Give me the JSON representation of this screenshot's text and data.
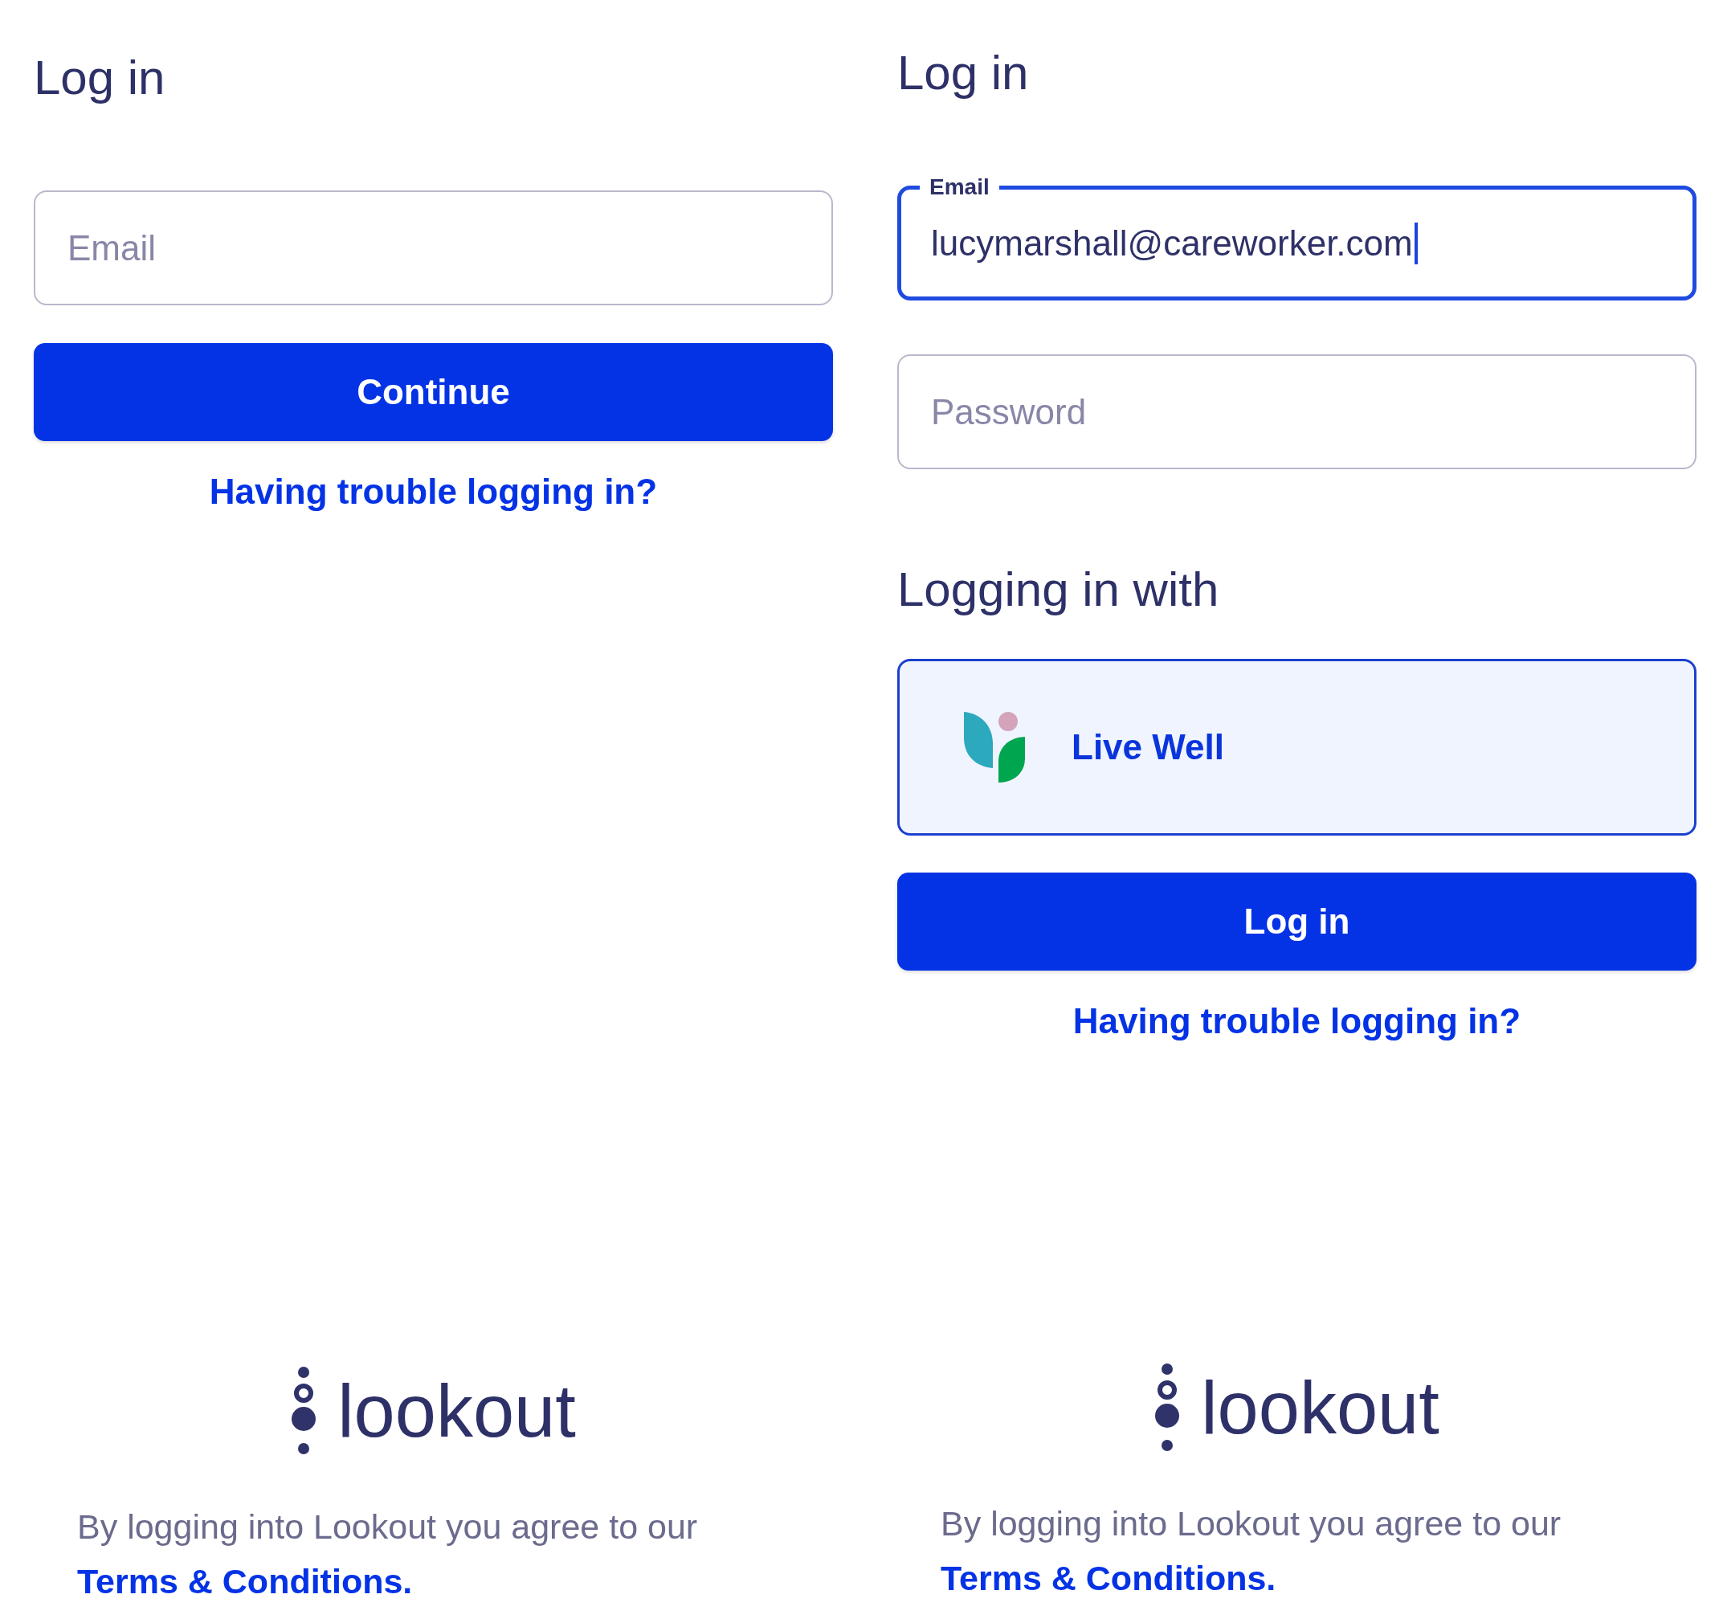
{
  "screens": [
    {
      "title": "Log in",
      "fields": [
        {
          "placeholder": "Email",
          "focused": false
        }
      ],
      "button": "Continue",
      "help_link": "Having trouble logging in?",
      "footer": {
        "logo": "lookout",
        "notice": "By logging into Lookout you agree to our",
        "terms_link": "Terms & Conditions."
      }
    },
    {
      "title": "Log in",
      "fields": [
        {
          "label": "Email",
          "value": "lucymarshall@careworker.com",
          "focused": true
        },
        {
          "placeholder": "Password",
          "focused": false
        }
      ],
      "provider_section": {
        "heading": "Logging in with",
        "providers": [
          {
            "name": "Live Well",
            "selected": true
          }
        ]
      },
      "button": "Log in",
      "help_link": "Having trouble logging in?",
      "footer": {
        "logo": "lookout",
        "notice": "By logging into Lookout you agree to our",
        "terms_link": "Terms & Conditions."
      }
    }
  ]
}
